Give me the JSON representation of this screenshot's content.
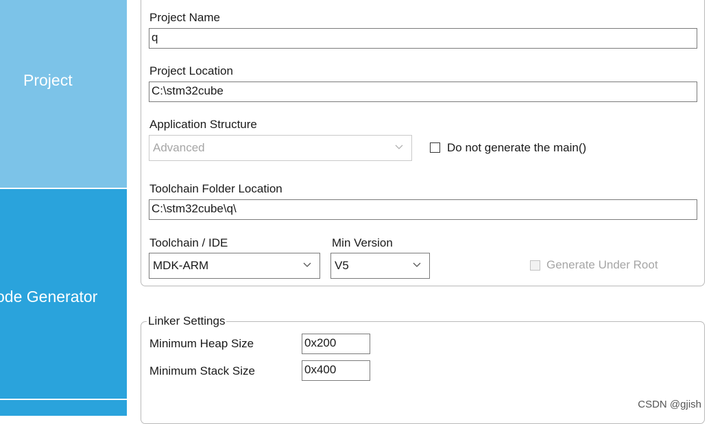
{
  "sidebar": {
    "items": [
      {
        "label": "Project",
        "state": "selected"
      },
      {
        "label": "ode Generator",
        "state": "normal"
      }
    ]
  },
  "project": {
    "name_label": "Project Name",
    "name_value": "q",
    "location_label": "Project Location",
    "location_value": "C:\\stm32cube",
    "structure_label": "Application Structure",
    "structure_value": "Advanced",
    "no_main_label": "Do not generate the main()",
    "no_main_checked": false,
    "toolchain_folder_label": "Toolchain Folder Location",
    "toolchain_folder_value": "C:\\stm32cube\\q\\",
    "toolchain_label": "Toolchain / IDE",
    "toolchain_value": "MDK-ARM",
    "min_version_label": "Min Version",
    "min_version_value": "V5",
    "gen_under_root_label": "Generate Under Root",
    "gen_under_root_checked": false
  },
  "linker": {
    "title": "Linker Settings",
    "heap_label": "Minimum Heap Size",
    "heap_value": "0x200",
    "stack_label": "Minimum Stack Size",
    "stack_value": "0x400"
  },
  "watermark": "CSDN @gjish",
  "colors": {
    "sidebar_selected": "#7cc3e8",
    "sidebar_normal": "#2aa3dc",
    "border": "#b9b9b9"
  }
}
